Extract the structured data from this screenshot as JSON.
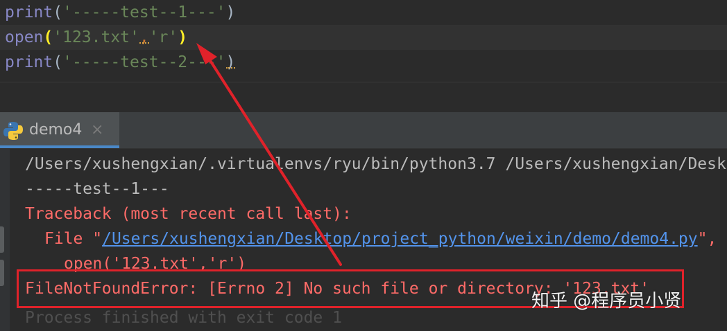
{
  "editor": {
    "line1": {
      "fn": "print",
      "open_paren": "(",
      "str": "'-----test--1---'",
      "close_paren": ")"
    },
    "line2": {
      "fn": "open",
      "open_paren": "(",
      "arg1": "'123.txt'",
      "comma": ",",
      "arg2": "'r'",
      "close_paren": ")"
    },
    "line3": {
      "fn": "print",
      "open_paren": "(",
      "str": "'-----test--2---'",
      "close_paren": ")"
    }
  },
  "run_tab": {
    "label": "demo4",
    "close": "×",
    "icon": "python-icon"
  },
  "console": {
    "command": "/Users/xushengxian/.virtualenvs/ryu/bin/python3.7 /Users/xushengxian/Desk",
    "test1": "-----test--1---",
    "traceback_header": "Traceback (most recent call last):",
    "file_prefix": "File \"",
    "file_link": "/Users/xushengxian/Desktop/project_python/weixin/demo/demo4.py",
    "file_suffix": "\",",
    "source_line": "open('123.txt','r')",
    "error_line": "FileNotFoundError: [Errno 2] No such file or directory: '123.txt'",
    "exit_line": "Process finished with exit code 1"
  },
  "watermark": "知乎 @程序员小贤",
  "colors": {
    "annotation": "#e0222a",
    "error_text": "#ff6b68",
    "link": "#5394ec",
    "string": "#6a8759",
    "builtin": "#8888c6"
  }
}
